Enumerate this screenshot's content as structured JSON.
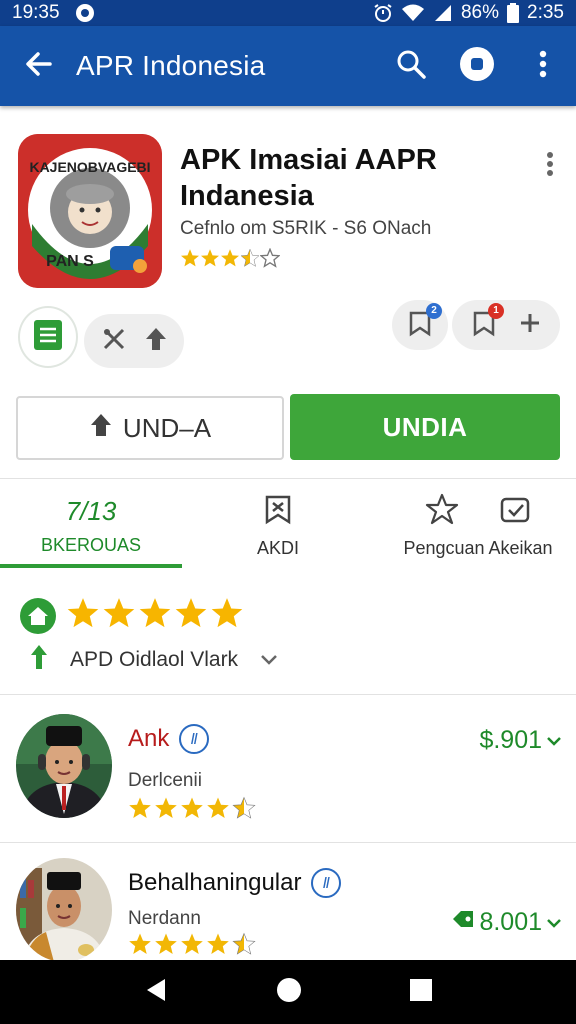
{
  "status_bar": {
    "time_left": "19:35",
    "battery": "86%",
    "time_right": "2:35",
    "icons": [
      "notification-icon",
      "alarm-icon",
      "wifi-icon",
      "signal-icon",
      "battery-icon"
    ]
  },
  "app_bar": {
    "title": "APR Indonesia",
    "icons": [
      "back-arrow-icon",
      "search-icon",
      "record-icon",
      "more-vertical-icon"
    ],
    "background": "#1553a8"
  },
  "app": {
    "name": "APK Imasiai AAPR Indanesia",
    "developer": "Cefnlo om  S5RIK - S6 ONach",
    "rating_stars": 3.5,
    "icon_logo_text_top": "KAJENOBVAGEBI",
    "icon_logo_text_bottom": "PAN S"
  },
  "chips": {
    "left": [
      "document-icon",
      "tools-icon",
      "upload-arrow-icon"
    ],
    "right": [
      {
        "icon": "bookmark-icon",
        "badge": "2",
        "badge_color": "#2f6fd0"
      },
      {
        "icon": "bookmark-icon",
        "badge": "1",
        "badge_color": "#d93025"
      },
      {
        "icon": "plus-icon"
      }
    ]
  },
  "buttons": {
    "secondary_label": "UND–A",
    "primary_label": "UNDIA",
    "primary_color": "#3ea63a"
  },
  "tabs": [
    {
      "label": "BKEROUAS",
      "icon_text": "7/13",
      "active": true
    },
    {
      "label": "AKDI",
      "icon": "bookmark-x-icon"
    },
    {
      "label": "Pengcuan Akeikan",
      "icon": "star-icon",
      "icon2": "folder-check-icon"
    }
  ],
  "rating": {
    "stars": 5,
    "sort_label": "APD Oidlaol Vlark"
  },
  "reviews": [
    {
      "name": "Ank",
      "verified_mark": "Ⅱ",
      "subtitle": "Derlcenii",
      "stars": 4.5,
      "price": "$.901",
      "name_color": "#b71c1c"
    },
    {
      "name": "Behalhaningular",
      "verified_mark": "Ⅱ",
      "subtitle": "Nerdann",
      "stars": 4.5,
      "price": "8.001",
      "name_color": "#111111"
    }
  ],
  "nav": {
    "icons": [
      "back-triangle-icon",
      "home-circle-icon",
      "recents-square-icon"
    ]
  }
}
